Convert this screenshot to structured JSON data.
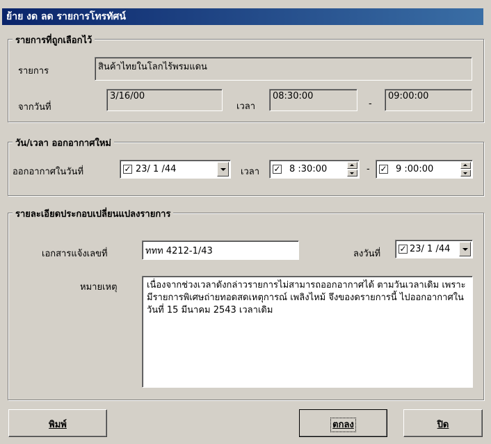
{
  "window": {
    "title": "ย้าย งด ลด รายการโทรทัศน์"
  },
  "selected_group": {
    "title": "รายการที่ถูกเลือกไว้",
    "program_label": "รายการ",
    "program_value": "สินค้าไทยในโลกไร้พรมแดน",
    "date_label": "จากวันที่",
    "date_value": "3/16/00",
    "time_label": "เวลา",
    "time_from": "08:30:00",
    "time_sep": "-",
    "time_to": "09:00:00"
  },
  "new_air_group": {
    "title": "วัน/เวลา ออกอากาศใหม่",
    "air_date_label": "ออกอากาศในวันที่",
    "air_date_checked": true,
    "air_date_value": "23/ 1 /44",
    "time_label": "เวลา",
    "time_from_checked": true,
    "time_from": "8 :30:00",
    "time_sep": "-",
    "time_to_checked": true,
    "time_to": "9 :00:00"
  },
  "details_group": {
    "title": "รายละเอียดประกอบเปลี่ยนแปลงรายการ",
    "doc_label": "เอกสารแจ้งเลขที่",
    "doc_value": "ททท 4212-1/43",
    "sign_date_label": "ลงวันที่",
    "sign_date_checked": true,
    "sign_date_value": "23/ 1 /44",
    "note_label": "หมายเหตุ",
    "note_value": "เนื่องจากช่วงเวลาดังกล่าวรายการไม่สามารถออกอากาศได้ ตามวันเวลาเดิม เพราะมีรายการพิเศษถ่ายทอดสดเหตุการณ์ เพลิงไหม้ จึงของดรายการนี้ ไปออกอากาศในวันที่ 15 มีนาคม 2543 เวลาเดิม"
  },
  "buttons": {
    "print": "พิมพ์",
    "ok": "ตกลง",
    "close": "ปิด"
  },
  "check_mark": "✓"
}
